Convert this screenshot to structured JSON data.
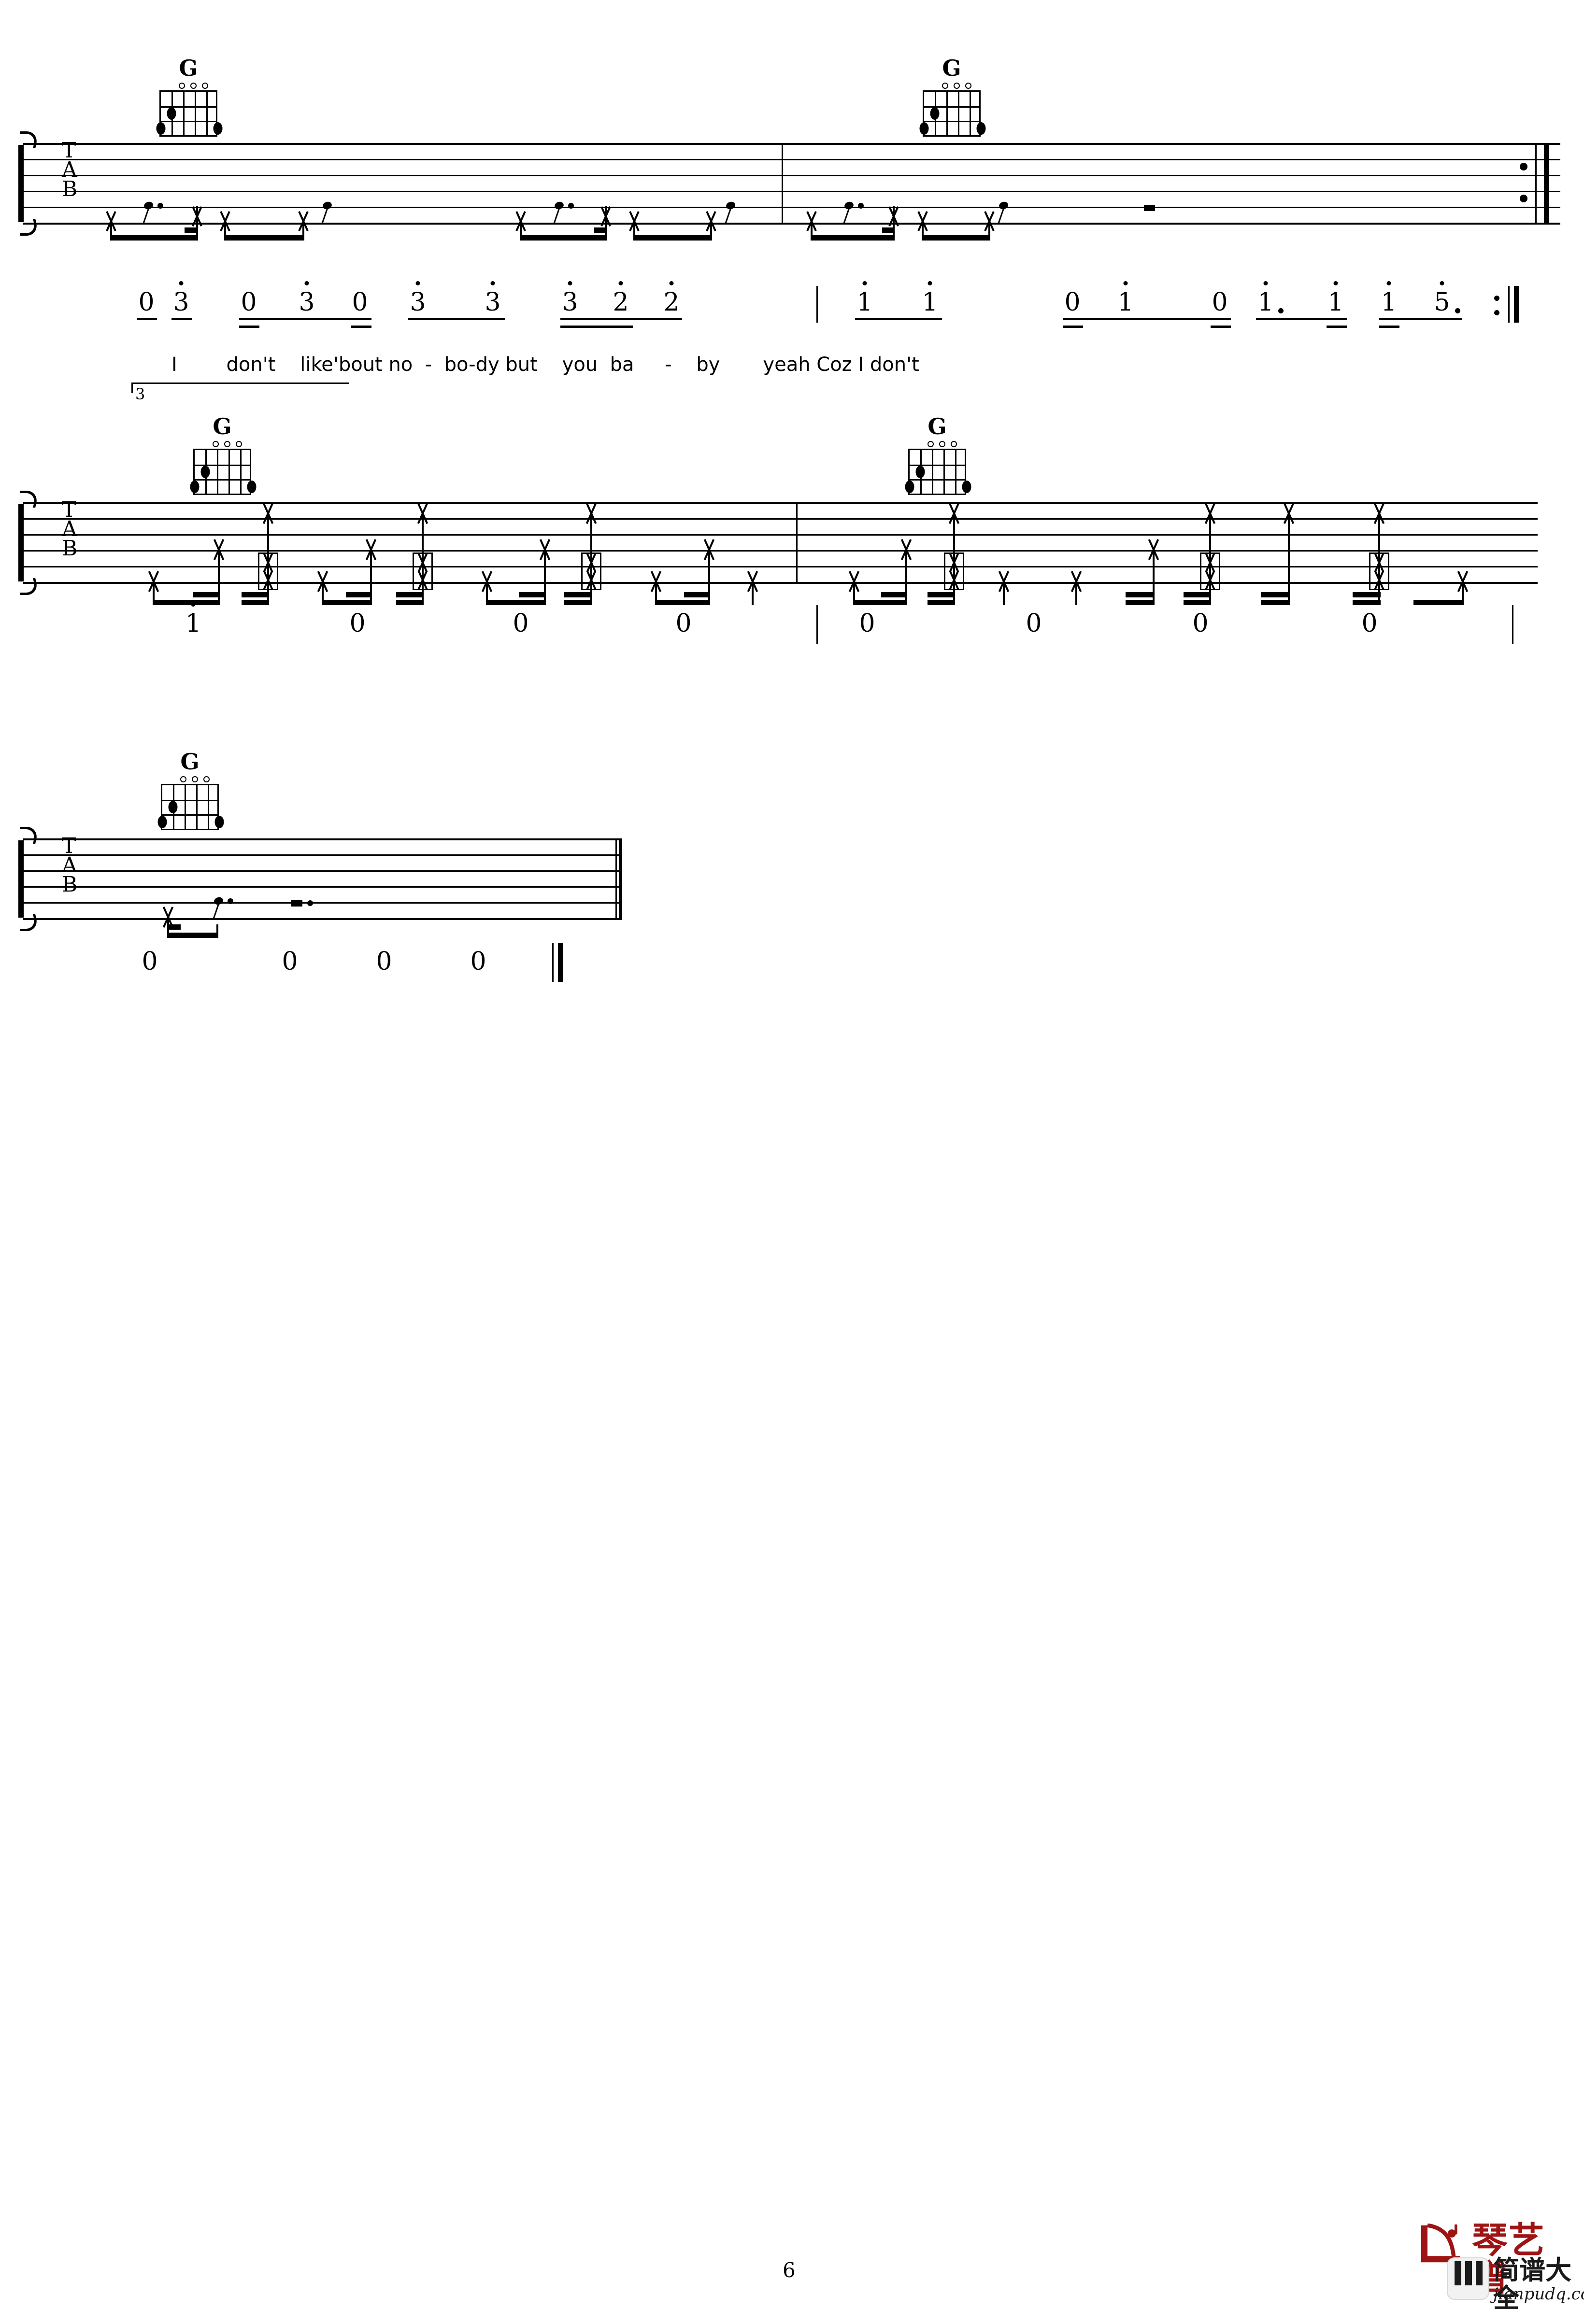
{
  "document": {
    "page_number": "6",
    "type": "guitar-tablature-with-jianpu"
  },
  "chord_diagrams": [
    {
      "name": "G",
      "frets": 5,
      "open_strings": [
        3,
        4,
        5
      ],
      "dots": [
        {
          "string": 2,
          "fret": 2
        },
        {
          "string": 1,
          "fret": 3
        },
        {
          "string": 6,
          "fret": 3
        }
      ]
    },
    {
      "name": "G",
      "frets": 5,
      "open_strings": [
        3,
        4,
        5
      ],
      "dots": [
        {
          "string": 2,
          "fret": 2
        },
        {
          "string": 1,
          "fret": 3
        },
        {
          "string": 6,
          "fret": 3
        }
      ]
    },
    {
      "name": "G",
      "frets": 5,
      "open_strings": [
        3,
        4,
        5
      ],
      "dots": [
        {
          "string": 2,
          "fret": 2
        },
        {
          "string": 1,
          "fret": 3
        },
        {
          "string": 6,
          "fret": 3
        }
      ]
    },
    {
      "name": "G",
      "frets": 5,
      "open_strings": [
        3,
        4,
        5
      ],
      "dots": [
        {
          "string": 2,
          "fret": 2
        },
        {
          "string": 1,
          "fret": 3
        },
        {
          "string": 6,
          "fret": 3
        }
      ]
    },
    {
      "name": "G",
      "frets": 5,
      "open_strings": [
        3,
        4,
        5
      ],
      "dots": [
        {
          "string": 2,
          "fret": 2
        },
        {
          "string": 1,
          "fret": 3
        },
        {
          "string": 6,
          "fret": 3
        }
      ]
    }
  ],
  "tab_clef": {
    "t": "T",
    "a": "A",
    "b": "B"
  },
  "volta": {
    "label": "3"
  },
  "systems": [
    {
      "id": "system-1",
      "end_barline": "repeat-end",
      "jianpu": [
        {
          "num": "0",
          "octave_up": false
        },
        {
          "num": "3",
          "octave_up": true
        },
        {
          "num": "0",
          "octave_up": false
        },
        {
          "num": "3",
          "octave_up": true
        },
        {
          "num": "0",
          "octave_up": false
        },
        {
          "num": "3",
          "octave_up": true
        },
        {
          "num": "3",
          "octave_up": true
        },
        {
          "num": "3",
          "octave_up": true
        },
        {
          "num": "2",
          "octave_up": true
        },
        {
          "num": "2",
          "octave_up": true
        },
        {
          "num": "1",
          "octave_up": true
        },
        {
          "num": "1",
          "octave_up": true
        },
        {
          "num": "0",
          "octave_up": false
        },
        {
          "num": "1",
          "octave_up": true
        },
        {
          "num": "0",
          "octave_up": false
        },
        {
          "num": "1",
          "octave_up": true,
          "dotted": true
        },
        {
          "num": "1",
          "octave_up": true
        },
        {
          "num": "1",
          "octave_up": true
        },
        {
          "num": "5",
          "octave_up": true,
          "dotted": true
        }
      ],
      "lyrics": "I        don't    like'bout no  -  bo-dy but    you  ba     -    by       yeah Coz I don't"
    },
    {
      "id": "system-2",
      "end_barline": "plain",
      "jianpu": [
        {
          "num": "1",
          "octave_up": true
        },
        {
          "num": "0",
          "octave_up": false
        },
        {
          "num": "0",
          "octave_up": false
        },
        {
          "num": "0",
          "octave_up": false
        },
        {
          "num": "0",
          "octave_up": false
        },
        {
          "num": "0",
          "octave_up": false
        },
        {
          "num": "0",
          "octave_up": false
        },
        {
          "num": "0",
          "octave_up": false
        }
      ],
      "lyrics": ""
    },
    {
      "id": "system-3",
      "end_barline": "final",
      "jianpu": [
        {
          "num": "0",
          "octave_up": false
        },
        {
          "num": "0",
          "octave_up": false
        },
        {
          "num": "0",
          "octave_up": false
        },
        {
          "num": "0",
          "octave_up": false
        }
      ],
      "lyrics": ""
    }
  ],
  "watermark": {
    "brand_cn": "琴艺谱",
    "sub_cn": "简谱大全",
    "url": "jianpudq.com",
    "brand_color": "#9e1313"
  }
}
